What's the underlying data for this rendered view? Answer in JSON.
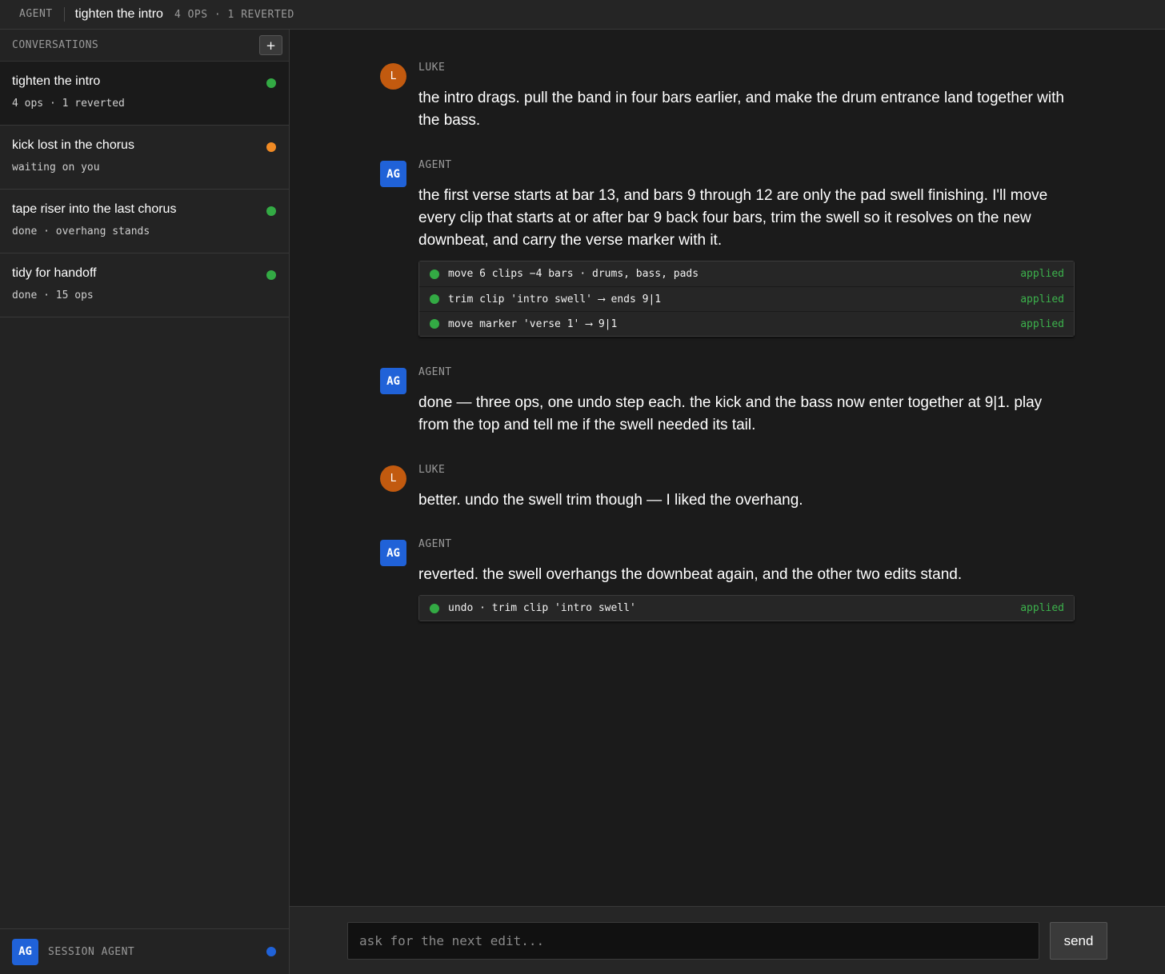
{
  "topbar": {
    "app_label": "AGENT",
    "title": "tighten the intro",
    "meta": "4 OPS · 1 REVERTED"
  },
  "sidebar": {
    "heading": "CONVERSATIONS",
    "new_button": "+",
    "conversations": [
      {
        "name": "tighten the intro",
        "sub": "4 ops · 1 reverted",
        "status_color": "#33aa44",
        "active": true
      },
      {
        "name": "kick lost in the chorus",
        "sub": "waiting on you",
        "status_color": "#f08a24",
        "active": false
      },
      {
        "name": "tape riser into the last chorus",
        "sub": "done · overhang stands",
        "status_color": "#33aa44",
        "active": false
      },
      {
        "name": "tidy for handoff",
        "sub": "done · 15 ops",
        "status_color": "#33aa44",
        "active": false
      }
    ],
    "footer": {
      "avatar": "AG",
      "label": "SESSION AGENT",
      "status_color": "#2062d8"
    }
  },
  "messages": [
    {
      "avatar": "L",
      "who": "LUKE",
      "body": "the intro drags. pull the band in four bars earlier, and make the drum entrance land together with the bass."
    },
    {
      "avatar": "AG",
      "who": "AGENT",
      "body": "the first verse starts at bar 13, and bars 9 through 12 are only the pad swell finishing. I'll move every clip that starts at or after bar 9 back four bars, trim the swell so it resolves on the new downbeat, and carry the verse marker with it.",
      "ops": [
        {
          "text": "move 6 clips −4 bars · drums, bass, pads",
          "status": "applied"
        },
        {
          "text": "trim clip 'intro swell' ⟶ ends 9|1",
          "status": "applied"
        },
        {
          "text": "move marker 'verse 1' ⟶ 9|1",
          "status": "applied"
        }
      ]
    },
    {
      "avatar": "AG",
      "who": "AGENT",
      "body": "done — three ops, one undo step each. the kick and the bass now enter together at 9|1. play from the top and tell me if the swell needed its tail."
    },
    {
      "avatar": "L",
      "who": "LUKE",
      "body": "better. undo the swell trim though — I liked the overhang."
    },
    {
      "avatar": "AG",
      "who": "AGENT",
      "body": "reverted. the swell overhangs the downbeat again, and the other two edits stand.",
      "ops": [
        {
          "text": "undo · trim clip 'intro swell'",
          "status": "applied"
        }
      ]
    }
  ],
  "composer": {
    "placeholder": "ask for the next edit...",
    "send_label": "send"
  },
  "colors": {
    "accent": "#2062d8",
    "user": "#c25a0f",
    "applied": "#3cb24c"
  }
}
